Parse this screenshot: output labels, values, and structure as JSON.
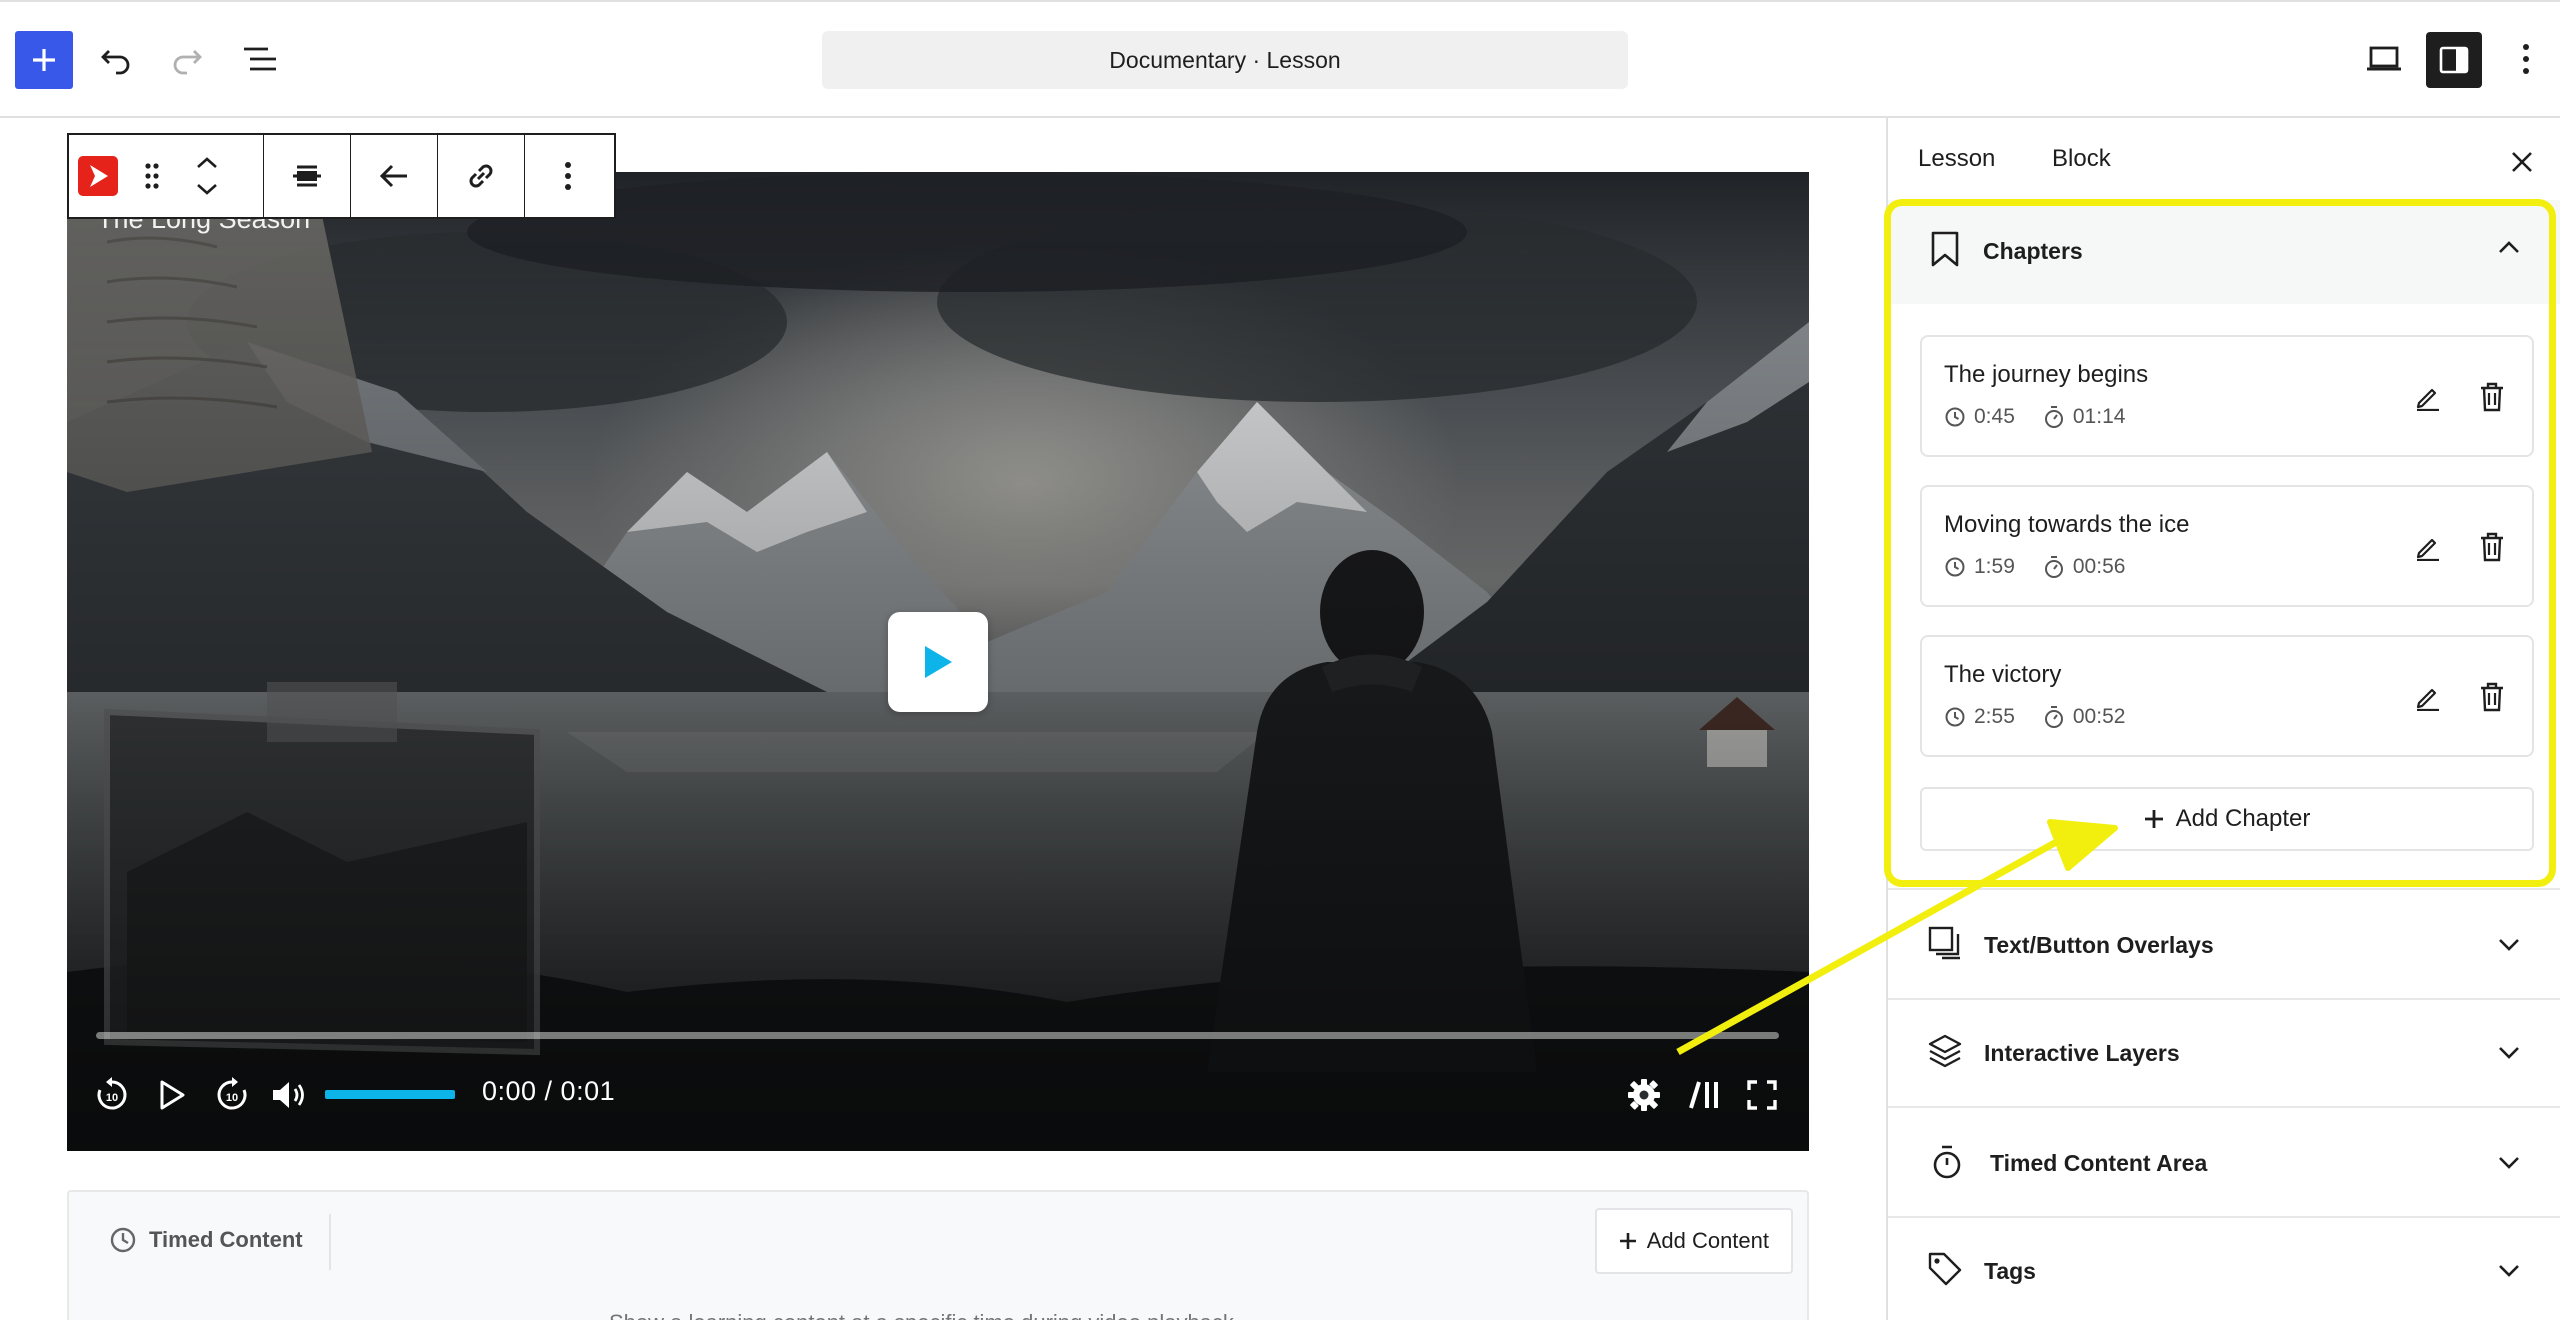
{
  "toolbar": {
    "document_title": "Documentary · Lesson"
  },
  "video": {
    "title": "The Long Season",
    "time_display": "0:00 / 0:01"
  },
  "timed_content": {
    "label": "Timed Content",
    "add_button": "Add Content",
    "cut_text": "Show a learning content at a specific time during video playback"
  },
  "sidebar": {
    "tabs": [
      "Lesson",
      "Block"
    ],
    "chapters": {
      "title": "Chapters",
      "items": [
        {
          "title": "The journey begins",
          "start": "0:45",
          "duration": "01:14"
        },
        {
          "title": "Moving towards the ice",
          "start": "1:59",
          "duration": "00:56"
        },
        {
          "title": "The victory",
          "start": "2:55",
          "duration": "00:52"
        }
      ],
      "add_label": "Add Chapter"
    },
    "panels": [
      {
        "label": "Text/Button Overlays",
        "icon": "overlays-icon"
      },
      {
        "label": "Interactive Layers",
        "icon": "layers-icon"
      },
      {
        "label": "Timed Content Area",
        "icon": "stopwatch-icon"
      },
      {
        "label": "Tags",
        "icon": "tag-icon"
      }
    ]
  },
  "colors": {
    "accent": "#3858e9",
    "highlight": "#f2ef0f",
    "volume": "#0cb4ea",
    "plugin_red": "#e5231b"
  }
}
